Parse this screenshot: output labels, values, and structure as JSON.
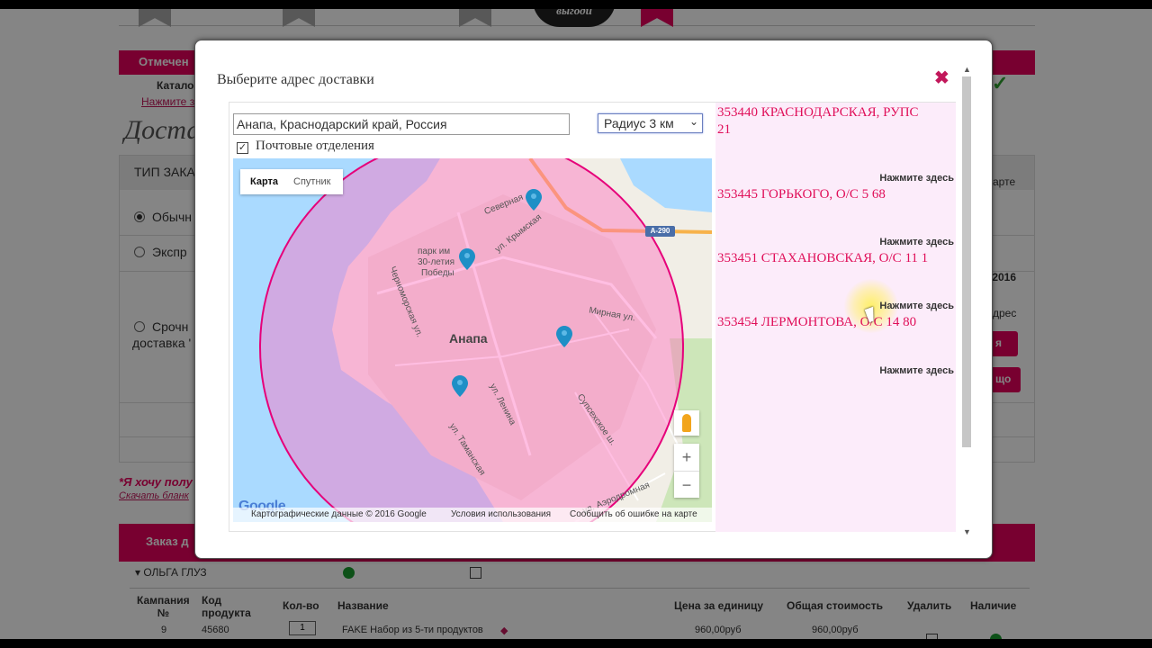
{
  "background": {
    "top_bar_label": "Отмечен",
    "catalog_label": "Катало",
    "click_here_link": "Нажмите з",
    "section_title": "Доста",
    "order_type_header": "ТИП ЗАКА",
    "options": [
      {
        "label": "Обычн",
        "selected": true
      },
      {
        "label": "Экспр",
        "selected": false
      },
      {
        "label": "Срочн",
        "selected": false,
        "label2": "доставка '"
      }
    ],
    "right_fragments": {
      "card": "арте",
      "date": "/2016",
      "address": "дрес",
      "button1": "я",
      "button2": "що"
    },
    "want_text": "*Я хочу полу",
    "download_link": "Скачать бланк",
    "orders_bar_label": "Заказ д",
    "owner_name": "ОЛЬГА ГЛУЗ",
    "table": {
      "headers": {
        "campaign": "Кампания\n№",
        "product_code": "Код\nпродукта",
        "qty": "Кол-во",
        "name": "Название",
        "unit_price": "Цена за единицу",
        "total": "Общая стоимость",
        "delete": "Удалить",
        "availability": "Наличие"
      },
      "rows": [
        {
          "campaign": "9",
          "product_code": "45680",
          "qty": "1",
          "name": "FAKE Набор из 5-ти продуктов",
          "unit_price": "960,00руб",
          "total": "960,00руб"
        }
      ]
    },
    "logo_text": "выгоди"
  },
  "modal": {
    "title": "Выберите адрес доставки",
    "close_glyph": "✖",
    "address_value": "Анапа, Краснодарский край, Россия",
    "radius_value": "Радиус 3 км",
    "post_offices_label": "Почтовые отделения",
    "post_offices_checked": true,
    "check_glyph": "✓",
    "map": {
      "tab_map": "Карта",
      "tab_satellite": "Спутник",
      "city_label": "Анапа",
      "route_label": "А-290",
      "street_labels": {
        "severnaya": "Северная",
        "krymskaya": "ул. Крымская",
        "park1": "парк им",
        "park2": "30-летия",
        "park3": "Победы",
        "chernomorskaya": "Черноморская ул.",
        "mirnaya": "Мирная ул.",
        "lenina": "ул. Ленина",
        "supsekhskoe": "Супсехское ш.",
        "tamanskaya": "ул. Таманская",
        "aerodromnaya": "ул. Аэродромная"
      },
      "zoom_in": "+",
      "zoom_out": "−",
      "google_logo": "Google",
      "footer_data": "Картографические данные © 2016 Google",
      "footer_terms": "Условия использования",
      "footer_report": "Сообщить об ошибке на карте",
      "accent_circle": "#e6007a",
      "marker_color": "#1e8fc6"
    },
    "offices": [
      {
        "name": "353440 КРАСНОДАРСКАЯ, РУПС\n21",
        "link": "Нажмите здесь"
      },
      {
        "name": "353445 ГОРЬКОГО, О/С 5 68",
        "link": "Нажмите здесь"
      },
      {
        "name": "353451 СТАХАНОВСКАЯ, О/С 11 1",
        "link": "Нажмите здесь"
      },
      {
        "name": "353454 ЛЕРМОНТОВА, О/С 14 80",
        "link": "Нажмите здесь"
      }
    ],
    "colors": {
      "accent": "#e6005c",
      "office_text": "#e0105a",
      "panel_bg": "#fcecfa"
    }
  }
}
